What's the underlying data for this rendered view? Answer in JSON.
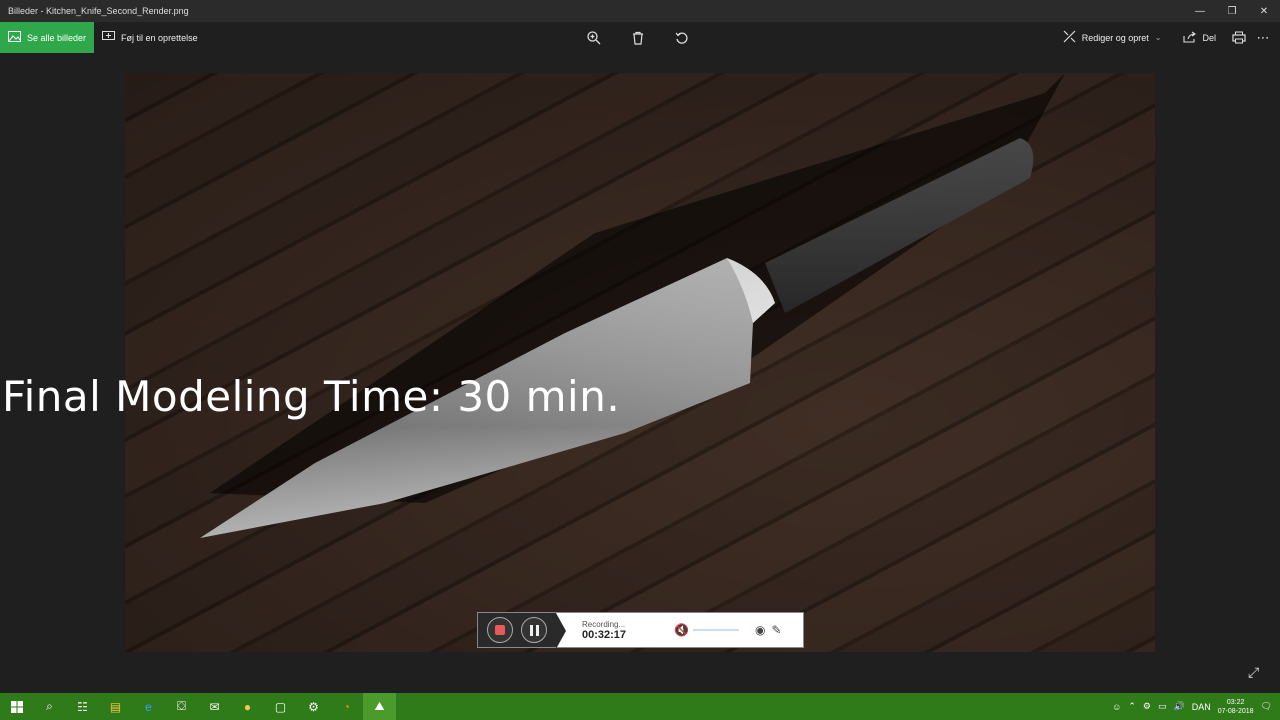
{
  "window": {
    "title": "Billeder - Kitchen_Knife_Second_Render.png"
  },
  "toolbar": {
    "see_all": "Se alle billeder",
    "add_to": "Føj til en oprettelse",
    "edit_create": "Rediger og opret",
    "share": "Del"
  },
  "caption": "Final Modeling Time: 30 min.",
  "recorder": {
    "status": "Recording...",
    "time": "00:32:17"
  },
  "tray": {
    "lang": "DAN",
    "time": "03:22",
    "date": "07-08-2018"
  },
  "icons": {
    "zoom": "zoom-in-icon",
    "delete": "trash-icon",
    "rotate": "rotate-icon",
    "edit": "edit-create-icon",
    "share": "share-icon",
    "print": "print-icon",
    "more": "more-icon"
  }
}
